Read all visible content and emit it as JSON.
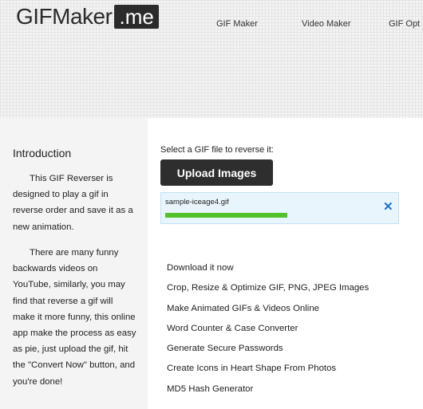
{
  "logo": {
    "main": "GIFMaker",
    "suffix": ".me"
  },
  "nav": [
    {
      "label": "GIF Maker"
    },
    {
      "label": "Video Maker"
    },
    {
      "label": "GIF Opt"
    }
  ],
  "sidebar": {
    "heading": "Introduction",
    "paragraphs": [
      "This GIF Reverser is designed to play a gif in reverse order and save it as a new animation.",
      "There are many funny backwards videos on YouTube, similarly, you may find that reverse a gif will make it more funny, this online app make the process as easy as pie, just upload the gif, hit the \"Convert Now\" button, and you're done!"
    ]
  },
  "main": {
    "select_label": "Select a GIF file to reverse it:",
    "upload_button": "Upload Images",
    "file": {
      "name": "sample-iceage4.gif",
      "progress": 1.0
    },
    "links": [
      "Download it now",
      "Crop, Resize & Optimize GIF, PNG, JPEG Images",
      "Make Animated GIFs & Videos Online",
      "Word Counter & Case Converter",
      "Generate Secure Passwords",
      "Create Icons in Heart Shape From Photos",
      "MD5 Hash Generator"
    ]
  },
  "icons": {
    "remove": "close-icon"
  },
  "colors": {
    "progress": "#52c22b",
    "remove_icon": "#1a73c8",
    "button": "#2e2e2e"
  }
}
